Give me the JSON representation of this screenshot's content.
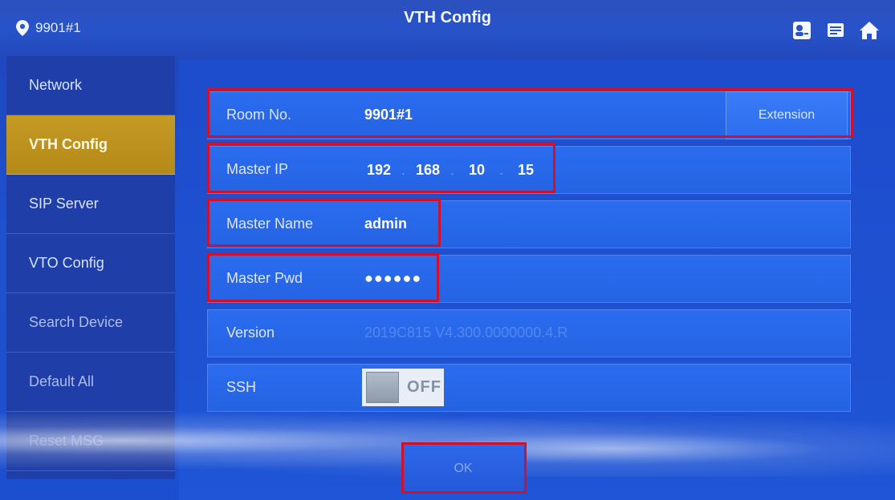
{
  "header": {
    "location": "9901#1",
    "title": "VTH Config",
    "icons": [
      "location-pin-icon",
      "contacts-icon",
      "messages-icon",
      "home-icon"
    ]
  },
  "sidebar": {
    "items": [
      {
        "label": "Network",
        "state": "normal"
      },
      {
        "label": "VTH Config",
        "state": "active"
      },
      {
        "label": "SIP Server",
        "state": "normal"
      },
      {
        "label": "VTO Config",
        "state": "normal"
      },
      {
        "label": "Search Device",
        "state": "normal"
      },
      {
        "label": "Default All",
        "state": "normal"
      },
      {
        "label": "Reset MSG",
        "state": "obscured"
      }
    ]
  },
  "form": {
    "room_no": {
      "label": "Room No.",
      "value": "9901#1",
      "button": "Extension"
    },
    "master_ip": {
      "label": "Master IP",
      "octets": [
        "192",
        "168",
        "10",
        "15"
      ],
      "separator": "."
    },
    "master_name": {
      "label": "Master Name",
      "value": "admin"
    },
    "master_pwd": {
      "label": "Master Pwd",
      "value": "●●●●●●"
    },
    "version": {
      "label": "Version",
      "value": "2019C815 V4.300.0000000.4.R"
    },
    "ssh": {
      "label": "SSH",
      "state": "OFF"
    }
  },
  "footer": {
    "ok_label": "OK"
  },
  "colors": {
    "background": "#1e50cf",
    "sidebar_active": "#c59a25",
    "row_fill": "#2b6cf0",
    "highlight": "#d0112e"
  }
}
